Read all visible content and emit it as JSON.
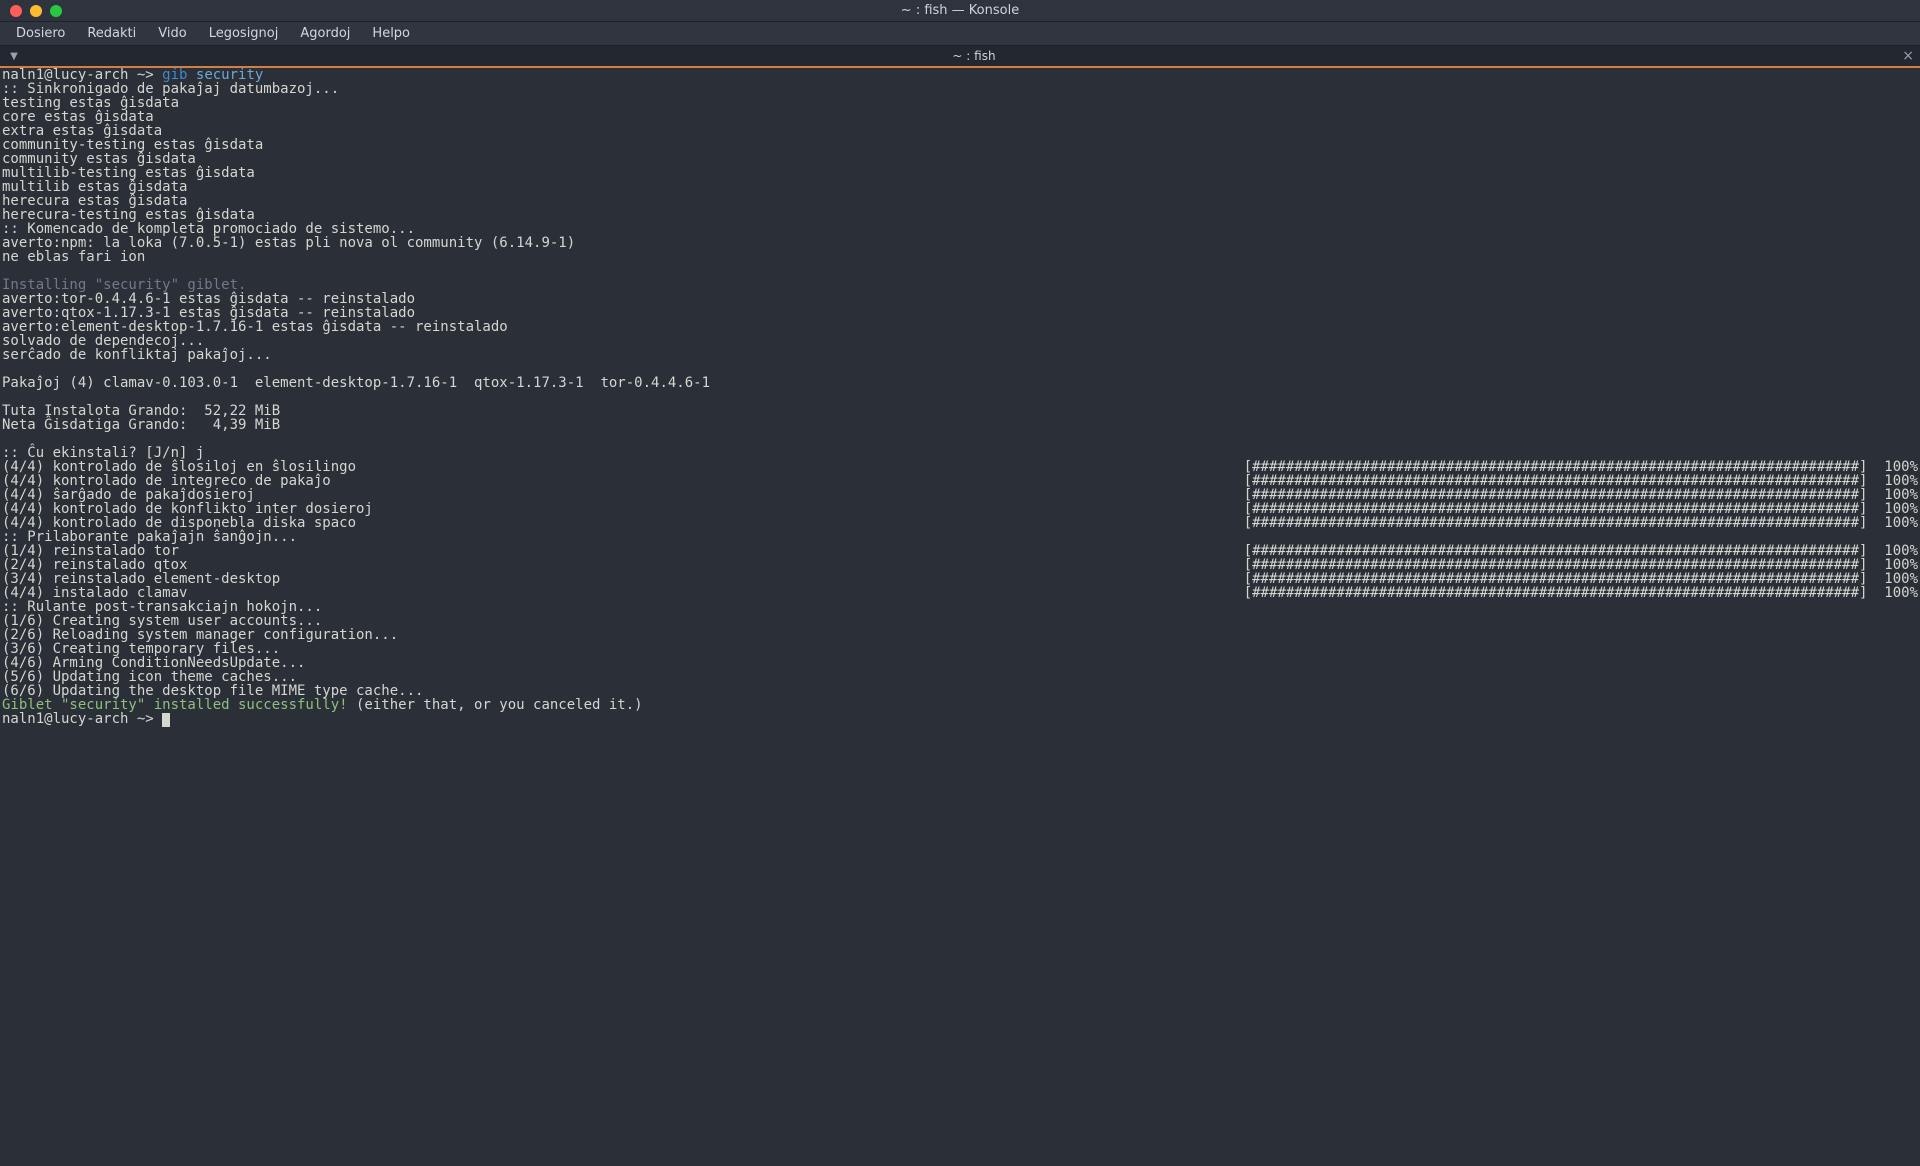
{
  "window": {
    "title": "~ : fish — Konsole"
  },
  "menubar": {
    "items": [
      {
        "label": "Dosiero"
      },
      {
        "label": "Redakti"
      },
      {
        "label": "Vido"
      },
      {
        "label": "Legosignoj"
      },
      {
        "label": "Agordoj"
      },
      {
        "label": "Helpo"
      }
    ]
  },
  "tabbar": {
    "new_tab_glyph": "▼",
    "tab_label": "~ : fish",
    "close_glyph": "×"
  },
  "prompt": {
    "user": "naln1",
    "host": "lucy-arch",
    "sep": "@",
    "path_indicator": "~>",
    "command_cmd": "gib",
    "command_arg": "security"
  },
  "output": {
    "lines_top": [
      ":: Sinkronigado de pakaĵaj datumbazoj...",
      "testing estas ĝisdata",
      "core estas ĝisdata",
      "extra estas ĝisdata",
      "community-testing estas ĝisdata",
      "community estas ĝisdata",
      "multilib-testing estas ĝisdata",
      "multilib estas ĝisdata",
      "herecura estas ĝisdata",
      "herecura-testing estas ĝisdata",
      ":: Komencado de kompleta promociado de sistemo...",
      "averto:npm: la loka (7.0.5-1) estas pli nova ol community (6.14.9-1)",
      "ne eblas fari ion",
      ""
    ],
    "installing_line": "Installing \"security\" giblet.",
    "lines_mid": [
      "averto:tor-0.4.4.6-1 estas ĝisdata -- reinstalado",
      "averto:qtox-1.17.3-1 estas ĝisdata -- reinstalado",
      "averto:element-desktop-1.7.16-1 estas ĝisdata -- reinstalado",
      "solvado de dependecoj...",
      "serĉado de konfliktaj pakaĵoj...",
      "",
      "Pakaĵoj (4) clamav-0.103.0-1  element-desktop-1.7.16-1  qtox-1.17.3-1  tor-0.4.4.6-1",
      "",
      "Tuta Instalota Grando:  52,22 MiB",
      "Neta Ĝisdatiga Grando:   4,39 MiB",
      "",
      ":: Ĉu ekinstali? [J/n] j"
    ],
    "progress_bar_hashes": "[########################################################################]",
    "progress_pct": "100%",
    "progress_rows_a": [
      "(4/4) kontrolado de ŝlosiloj en ŝlosilingo",
      "(4/4) kontrolado de integreco de pakaĵo",
      "(4/4) ŝarĝado de pakaĵdosieroj",
      "(4/4) kontrolado de konflikto inter dosieroj",
      "(4/4) kontrolado de disponebla diska spaco"
    ],
    "between_progress": ":: Prilaborante pakaĵajn ŝanĝojn...",
    "progress_rows_b": [
      "(1/4) reinstalado tor",
      "(2/4) reinstalado qtox",
      "(3/4) reinstalado element-desktop",
      "(4/4) instalado clamav"
    ],
    "lines_post": [
      ":: Rulante post-transakciajn hokojn...",
      "(1/6) Creating system user accounts...",
      "(2/6) Reloading system manager configuration...",
      "(3/6) Creating temporary files...",
      "(4/6) Arming ConditionNeedsUpdate...",
      "(5/6) Updating icon theme caches...",
      "(6/6) Updating the desktop file MIME type cache..."
    ],
    "success_green": "Giblet \"security\" installed successfully!",
    "success_suffix": " (either that, or you canceled it.)"
  }
}
